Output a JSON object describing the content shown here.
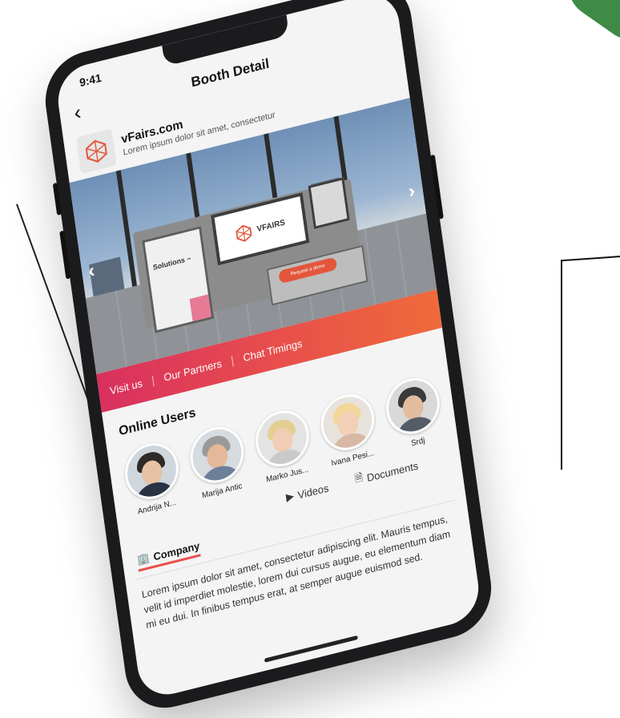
{
  "status_bar": {
    "time": "9:41"
  },
  "nav": {
    "title": "Booth Detail",
    "back_icon": "chevron-left-icon"
  },
  "company": {
    "name": "vFairs.com",
    "subtitle": "Lorem ipsum dolor sit amet, consectetur"
  },
  "booth": {
    "panel_text": "Solutions ~",
    "logo_text": "VFAIRS",
    "button_label": "Request a demo"
  },
  "banner_tabs": [
    "Visit us",
    "Our Partners",
    "Chat Timings"
  ],
  "online_users": {
    "title": "Online Users",
    "users": [
      {
        "name": "Andrija N..."
      },
      {
        "name": "Marija Antic"
      },
      {
        "name": "Marko Jus..."
      },
      {
        "name": "Ivana Pesi..."
      },
      {
        "name": "Srdj"
      }
    ]
  },
  "content_tabs": {
    "company": "Company",
    "videos": "Videos",
    "documents": "Documents"
  },
  "description": "Lorem ipsum dolor sit amet, consectetur adipiscing elit. Mauris tempus, velit id imperdiet molestie, lorem dui cursus augue, eu elementum diam mi eu dui. In finibus tempus erat, at semper augue euismod sed.",
  "colors": {
    "accent_start": "#d9305f",
    "accent_end": "#ef6a3a",
    "corner_green": "#3f8a47"
  }
}
